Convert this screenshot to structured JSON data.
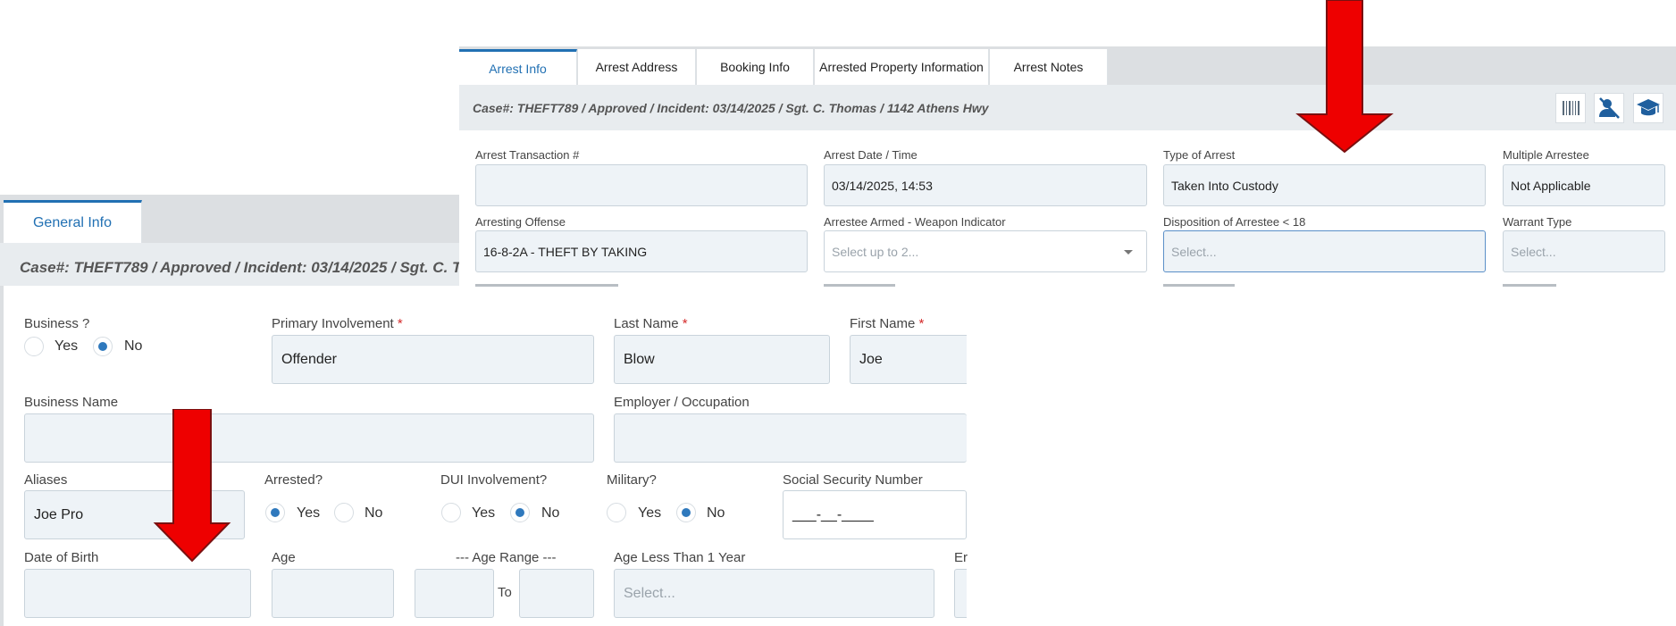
{
  "back_window": {
    "tab_general_info": "General Info",
    "case_banner": "Case#: THEFT789 / Approved / Incident: 03/14/2025 / Sgt. C. T",
    "fields": {
      "business_label": "Business ?",
      "business_yes": "Yes",
      "business_no": "No",
      "primary_involvement_label": "Primary Involvement",
      "primary_involvement_value": "Offender",
      "last_name_label": "Last Name",
      "last_name_value": "Blow",
      "first_name_label": "First Name",
      "first_name_value": "Joe",
      "business_name_label": "Business Name",
      "employer_label": "Employer / Occupation",
      "aliases_label": "Aliases",
      "aliases_value": "Joe Pro",
      "arrested_label": "Arrested?",
      "arrested_yes": "Yes",
      "arrested_no": "No",
      "dui_label": "DUI Involvement?",
      "dui_yes": "Yes",
      "dui_no": "No",
      "military_label": "Military?",
      "military_yes": "Yes",
      "military_no": "No",
      "ssn_label": "Social Security Number",
      "ssn_value": "___-__-____",
      "dob_label": "Date of Birth",
      "age_label": "Age",
      "age_range_label": "--- Age Range ---",
      "age_range_to": "To",
      "age_less_label": "Age Less Than 1 Year",
      "age_less_placeholder": "Select...",
      "partial_label": "Er",
      "required_mark": "*"
    },
    "states": {
      "business": "No",
      "arrested": "Yes",
      "dui": "No",
      "military": "No"
    }
  },
  "front_window": {
    "tabs": [
      "Arrest Info",
      "Arrest Address",
      "Booking Info",
      "Arrested Property Information",
      "Arrest Notes"
    ],
    "active_tab": "Arrest Info",
    "case_banner": "Case#: THEFT789 / Approved / Incident: 03/14/2025 / Sgt. C. Thomas / 1142 Athens Hwy",
    "toolbar_icons": [
      "barcode-icon",
      "user-remove-icon",
      "graduation-cap-icon"
    ],
    "fields": {
      "transaction_label": "Arrest Transaction #",
      "arrest_date_label": "Arrest Date / Time",
      "arrest_date_value": "03/14/2025, 14:53",
      "type_label": "Type of Arrest",
      "type_value": "Taken Into Custody",
      "multiple_label": "Multiple Arrestee",
      "multiple_value": "Not Applicable",
      "offense_label": "Arresting Offense",
      "offense_value": "16-8-2A - THEFT BY TAKING",
      "armed_label": "Arrestee Armed - Weapon Indicator",
      "armed_placeholder": "Select up to 2...",
      "disposition_label": "Disposition of Arrestee < 18",
      "disposition_placeholder": "Select...",
      "warrant_label": "Warrant Type",
      "warrant_placeholder": "Select..."
    }
  },
  "annotations": {
    "arrow_color": "#ee0000",
    "arrow_outline": "#7a1010"
  }
}
